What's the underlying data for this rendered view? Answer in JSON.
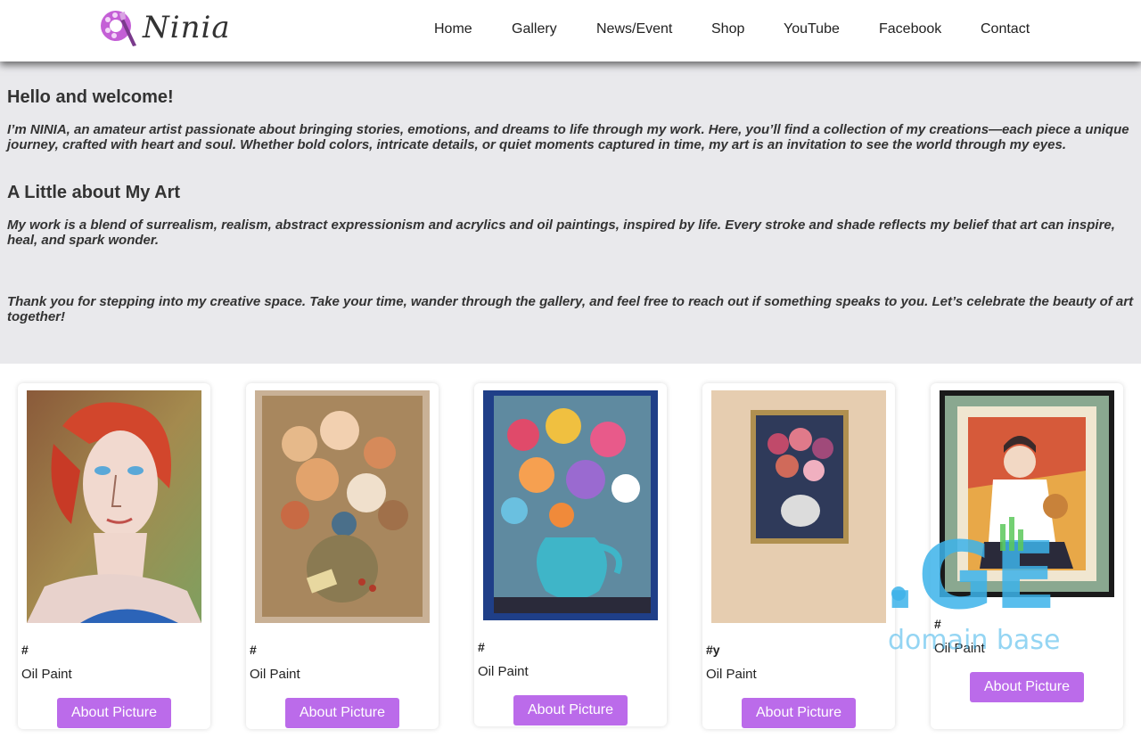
{
  "header": {
    "logo_text": "Ninia",
    "nav": [
      "Home",
      "Gallery",
      "News/Event",
      "Shop",
      "YouTube",
      "Facebook",
      "Contact"
    ]
  },
  "intro": {
    "heading1": "Hello and welcome!",
    "para1": "I’m NINIA, an amateur artist passionate about bringing stories, emotions, and dreams to life through my work. Here, you’ll find a collection of my creations—each piece a unique journey, crafted with heart and soul. Whether bold colors, intricate details, or quiet moments captured in time, my art is an invitation to see the world through my eyes.",
    "heading2": "A Little about My Art",
    "para2": "My work is a blend of surrealism, realism, abstract expressionism and acrylics and oil paintings, inspired by life. Every stroke and shade reflects my belief that art can inspire, heal, and spark wonder.",
    "para3": "Thank you for stepping into my creative space. Take your time, wander through the gallery, and feel free to reach out if something speaks to you. Let’s celebrate the beauty of art together!"
  },
  "gallery": {
    "cards": [
      {
        "tag": "#",
        "medium": "Oil Paint",
        "button": "About Picture"
      },
      {
        "tag": "#",
        "medium": "Oil Paint",
        "button": "About Picture"
      },
      {
        "tag": "#",
        "medium": "Oil Paint",
        "button": "About Picture"
      },
      {
        "tag": "#y",
        "medium": "Oil Paint",
        "button": "About Picture"
      },
      {
        "tag": "#",
        "medium": "Oil Paint",
        "button": "About Picture"
      }
    ]
  },
  "watermark": {
    "mark": ".GE",
    "text": "domain base"
  },
  "colors": {
    "accent": "#bb6bea",
    "intro_bg": "#e9e9ec",
    "watermark": "#3db3ea"
  },
  "icons": {
    "logo": "paint-palette-icon"
  }
}
